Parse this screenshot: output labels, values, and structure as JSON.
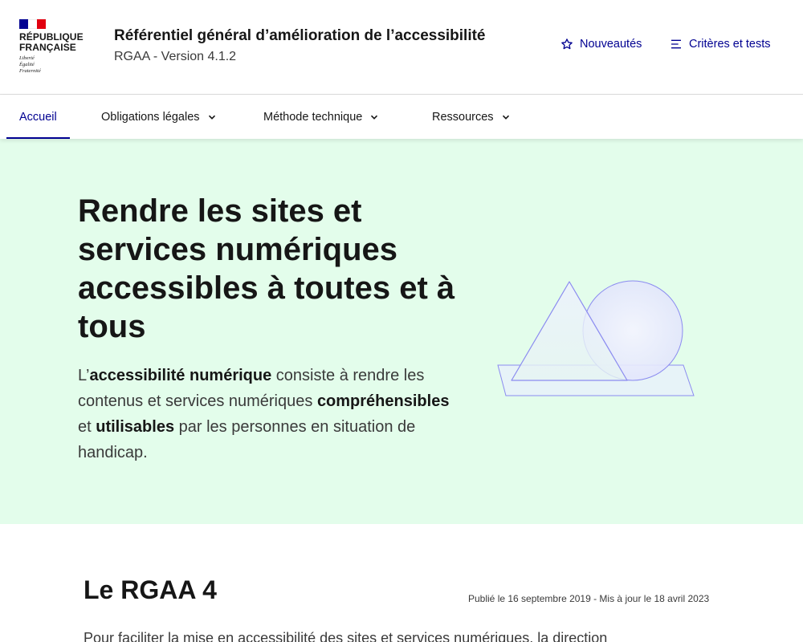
{
  "header": {
    "logo": {
      "line1": "RÉPUBLIQUE",
      "line2": "FRANÇAISE",
      "devise": [
        "Liberté",
        "Égalité",
        "Fraternité"
      ]
    },
    "title": "Référentiel général d’amélioration de l’accessibilité",
    "tagline": "RGAA - Version 4.1.2",
    "tools": {
      "news_label": "Nouveautés",
      "news_icon": "star-outline-icon",
      "criteria_label": "Critères et tests",
      "criteria_icon": "menu-lines-icon"
    }
  },
  "nav": {
    "items": [
      {
        "label": "Accueil",
        "active": true
      },
      {
        "label": "Obligations légales",
        "dropdown": true
      },
      {
        "label": "Méthode technique",
        "dropdown": true
      },
      {
        "label": "Ressources",
        "dropdown": true
      }
    ]
  },
  "hero": {
    "title": "Rendre les sites et services numériques accessibles à toutes et à tous",
    "text": {
      "p1": "L’",
      "b1": "accessibilité numérique",
      "p2": " consiste à rendre les contenus et services numériques ",
      "b2": "compréhensibles",
      "p3": " et ",
      "b3": "utilisables",
      "p4": " par les personnes en situation de handicap."
    }
  },
  "section": {
    "title": "Le RGAA 4",
    "date": "Publié le 16 septembre 2019 - Mis à jour le 18 avril 2023",
    "intro": "Pour faciliter la mise en accessibilité des sites et services numériques, la direction"
  },
  "colors": {
    "primary": "#000091",
    "hero_bg": "#e3fdeb",
    "flag_blue": "#000091",
    "flag_red": "#e1000f",
    "illustration_stroke": "#6a6af4"
  }
}
